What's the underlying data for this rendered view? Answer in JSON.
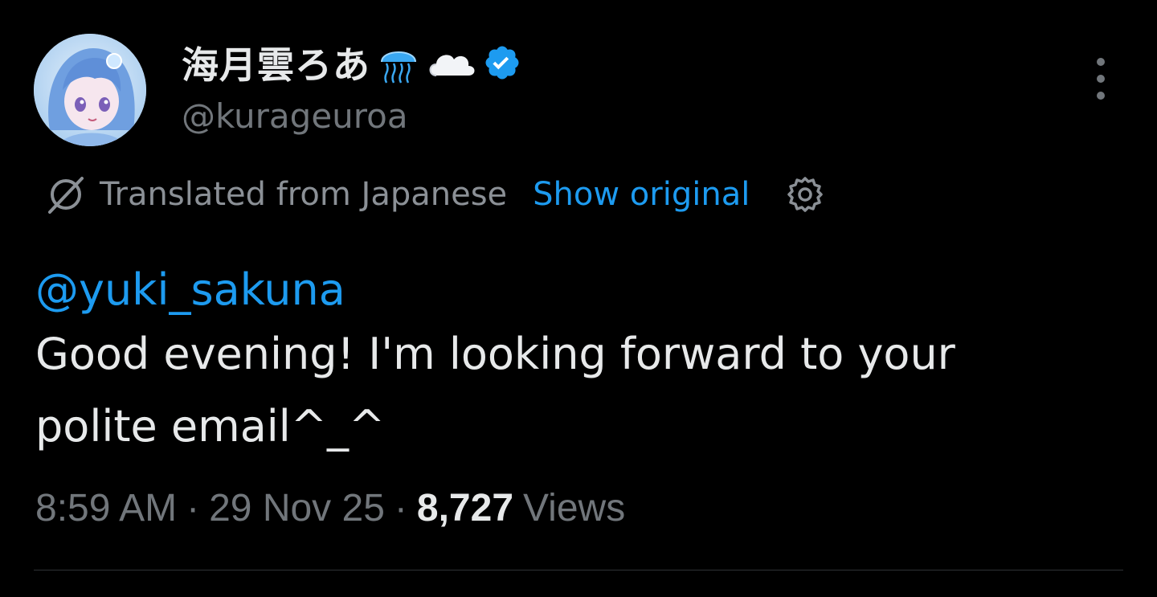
{
  "author": {
    "display_name": "海月雲ろあ",
    "handle": "@kurageuroa",
    "name_emoji": [
      "jellyfish-icon",
      "cloud-icon"
    ],
    "verified": true,
    "verified_color": "#1d9bf0"
  },
  "translation": {
    "label": "Translated from Japanese",
    "action_label": "Show original",
    "icon": "translate-icon",
    "settings_icon": "gear-icon"
  },
  "tweet": {
    "mention": "@yuki_sakuna",
    "text": "Good evening! I'm looking forward to your polite email^_^"
  },
  "meta": {
    "time": "8:59 AM",
    "separator": "·",
    "date": "29 Nov 25",
    "views_count": "8,727",
    "views_label": "Views"
  },
  "colors": {
    "background": "#000000",
    "text_primary": "#e7e9ea",
    "text_secondary": "#71767b",
    "accent": "#1d9bf0",
    "divider": "#2f3336"
  }
}
